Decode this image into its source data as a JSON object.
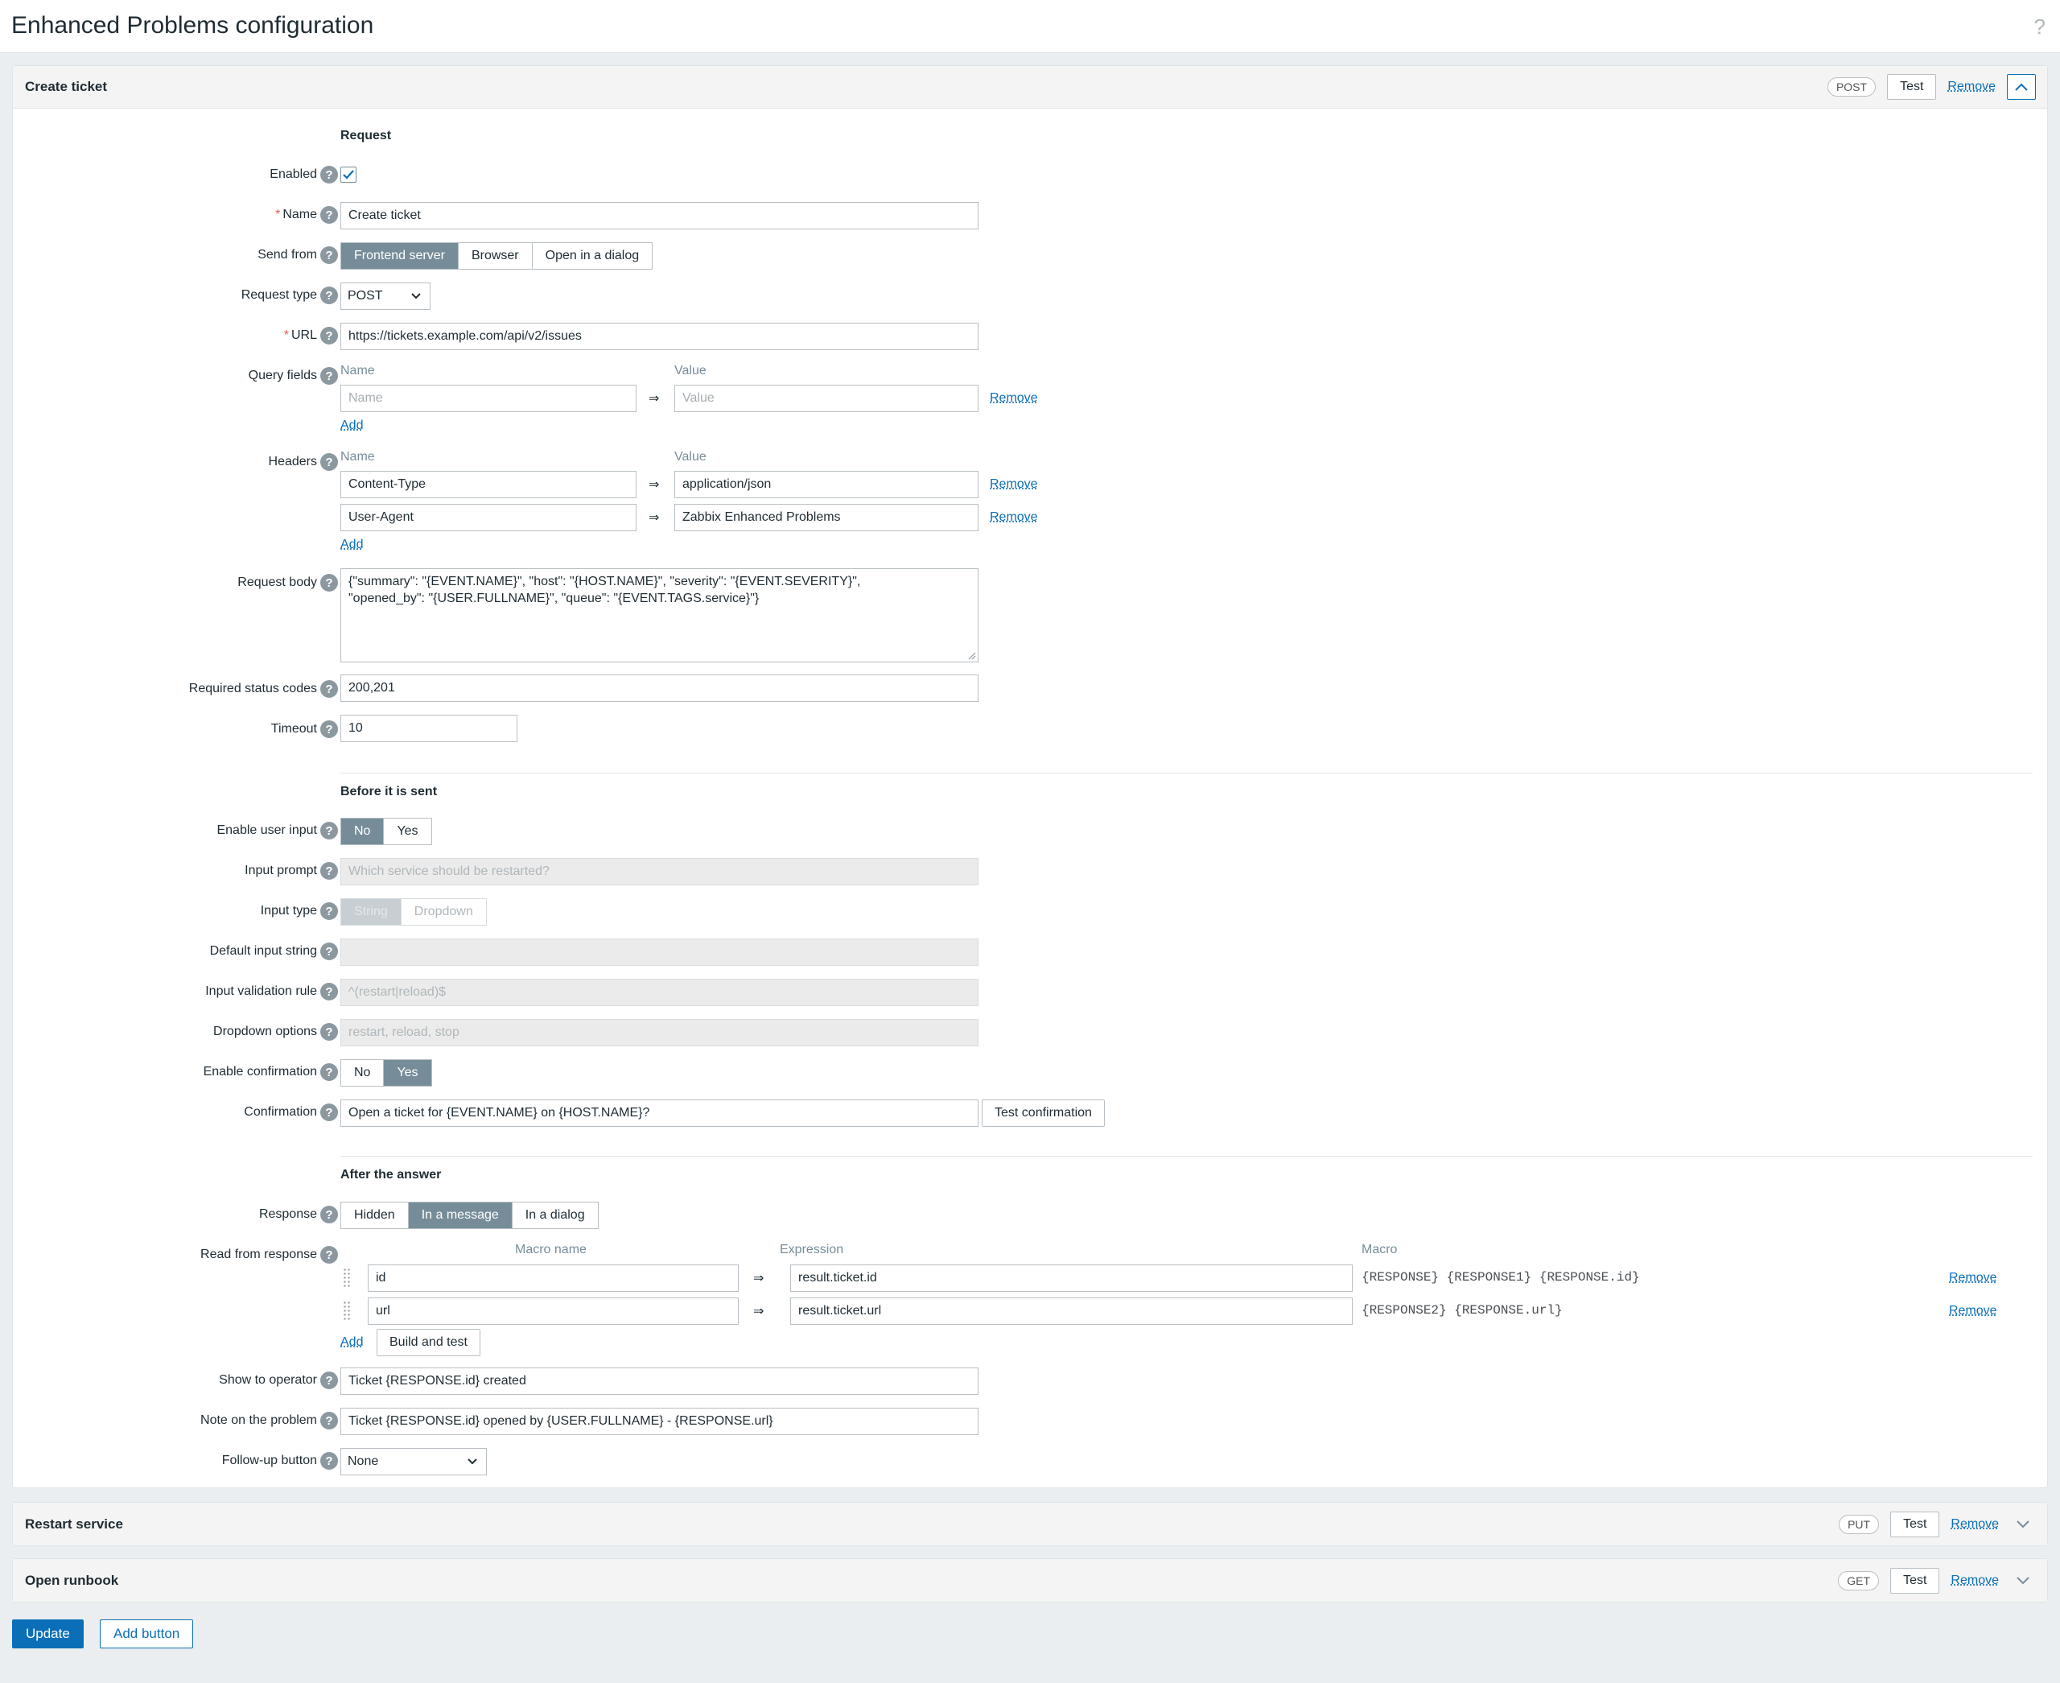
{
  "page": {
    "title": "Enhanced Problems configuration",
    "help": "?"
  },
  "create": {
    "title": "Create ticket",
    "method": "POST",
    "test": "Test",
    "remove": "Remove",
    "request_title": "Request",
    "enabled_label": "Enabled",
    "name_label": "Name",
    "name_value": "Create ticket",
    "send_from_label": "Send from",
    "send_from_options": [
      "Frontend server",
      "Browser",
      "Open in a dialog"
    ],
    "request_type_label": "Request type",
    "request_type_value": "POST",
    "url_label": "URL",
    "url_value": "https://tickets.example.com/api/v2/issues",
    "query_label": "Query fields",
    "col_name": "Name",
    "col_value": "Value",
    "query_name_ph": "Name",
    "query_value_ph": "Value",
    "headers_label": "Headers",
    "headers": [
      {
        "name": "Content-Type",
        "value": "application/json"
      },
      {
        "name": "User-Agent",
        "value": "Zabbix Enhanced Problems"
      }
    ],
    "arrow": "⇒",
    "add": "Add",
    "body_label": "Request body",
    "body_line1": "{\"summary\": \"{EVENT.NAME}\", \"host\": \"{HOST.NAME}\", \"severity\": \"{EVENT.SEVERITY}\",",
    "body_line2": "\"opened_by\": \"{USER.FULLNAME}\", \"queue\": \"{EVENT.TAGS.service}\"}",
    "status_label": "Required status codes",
    "status_value": "200,201",
    "timeout_label": "Timeout",
    "timeout_value": "10",
    "before_title": "Before it is sent",
    "user_input_label": "Enable user input",
    "no": "No",
    "yes": "Yes",
    "prompt_label": "Input prompt",
    "prompt_ph": "Which service should be restarted?",
    "input_type_label": "Input type",
    "input_type_options": [
      "String",
      "Dropdown"
    ],
    "default_label": "Default input string",
    "validation_label": "Input validation rule",
    "validation_ph": "^(restart|reload)$",
    "dropdown_label": "Dropdown options",
    "dropdown_ph": "restart, reload, stop",
    "confirm_enable_label": "Enable confirmation",
    "confirm_label": "Confirmation",
    "confirm_value": "Open a ticket for {EVENT.NAME} on {HOST.NAME}?",
    "test_confirm": "Test confirmation",
    "after_title": "After the answer",
    "response_label": "Response",
    "response_options": [
      "Hidden",
      "In a message",
      "In a dialog"
    ],
    "read_label": "Read from response",
    "col_macro_name": "Macro name",
    "col_expression": "Expression",
    "col_macro": "Macro",
    "read_rows": [
      {
        "name": "id",
        "expr": "result.ticket.id",
        "macro": "{RESPONSE} {RESPONSE1} {RESPONSE.id}"
      },
      {
        "name": "url",
        "expr": "result.ticket.url",
        "macro": "{RESPONSE2} {RESPONSE.url}"
      }
    ],
    "build_test": "Build and test",
    "show_label": "Show to operator",
    "show_value": "Ticket {RESPONSE.id} created",
    "note_label": "Note on the problem",
    "note_value": "Ticket {RESPONSE.id} opened by {USER.FULLNAME} - {RESPONSE.url}",
    "followup_label": "Follow-up button",
    "followup_value": "None"
  },
  "restart": {
    "title": "Restart service",
    "method": "PUT",
    "test": "Test",
    "remove": "Remove"
  },
  "runbook": {
    "title": "Open runbook",
    "method": "GET",
    "test": "Test",
    "remove": "Remove"
  },
  "footer": {
    "update": "Update",
    "add_button": "Add button"
  }
}
